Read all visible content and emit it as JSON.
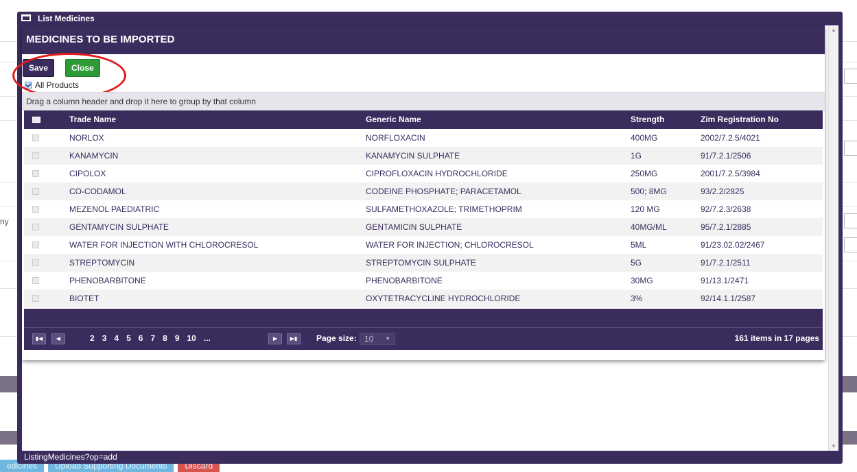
{
  "window": {
    "title": "List Medicines",
    "status_text": "ListingMedicines?op=add"
  },
  "panel": {
    "title": "MEDICINES TO BE IMPORTED",
    "save_label": "Save",
    "close_label": "Close",
    "all_products_label": "All Products",
    "all_products_checked": true
  },
  "grid": {
    "group_hint": "Drag a column header and drop it here to group by that column",
    "columns": [
      "Trade Name",
      "Generic Name",
      "Strength",
      "Zim Registration No"
    ],
    "rows": [
      {
        "trade": "NORLOX",
        "generic": "NORFLOXACIN",
        "strength": "400MG",
        "reg": "2002/7.2.5/4021"
      },
      {
        "trade": "KANAMYCIN",
        "generic": "KANAMYCIN SULPHATE",
        "strength": "1G",
        "reg": "91/7.2.1/2506"
      },
      {
        "trade": "CIPOLOX",
        "generic": "CIPROFLOXACIN HYDROCHLORIDE",
        "strength": "250MG",
        "reg": "2001/7.2.5/3984"
      },
      {
        "trade": "CO-CODAMOL",
        "generic": "CODEINE PHOSPHATE; PARACETAMOL",
        "strength": "500; 8MG",
        "reg": "93/2.2/2825"
      },
      {
        "trade": "MEZENOL PAEDIATRIC",
        "generic": "SULFAMETHOXAZOLE; TRIMETHOPRIM",
        "strength": "120 MG",
        "reg": "92/7.2.3/2638"
      },
      {
        "trade": "GENTAMYCIN SULPHATE",
        "generic": "GENTAMICIN SULPHATE",
        "strength": "40MG/ML",
        "reg": "95/7.2.1/2885"
      },
      {
        "trade": "WATER FOR INJECTION WITH CHLOROCRESOL",
        "generic": "WATER FOR INJECTION; CHLOROCRESOL",
        "strength": "5ML",
        "reg": "91/23.02.02/2467"
      },
      {
        "trade": "STREPTOMYCIN",
        "generic": "STREPTOMYCIN SULPHATE",
        "strength": "5G",
        "reg": "91/7.2.1/2511"
      },
      {
        "trade": "PHENOBARBITONE",
        "generic": "PHENOBARBITONE",
        "strength": "30MG",
        "reg": "91/13.1/2471"
      },
      {
        "trade": "BIOTET",
        "generic": "OXYTETRACYCLINE HYDROCHLORIDE",
        "strength": "3%",
        "reg": "92/14.1.1/2587"
      }
    ]
  },
  "pager": {
    "pages": [
      "2",
      "3",
      "4",
      "5",
      "6",
      "7",
      "8",
      "9",
      "10",
      "..."
    ],
    "page_size_label": "Page size:",
    "page_size_value": "10",
    "info": "161 items in 17 pages"
  },
  "background": {
    "tabs": [
      "edicines",
      "Upload Supporting Documents",
      "Discard"
    ],
    "tab_colors": [
      "#6fb7de",
      "#6fb7de",
      "#d9534f"
    ],
    "side_text": "ny"
  },
  "colors": {
    "primary": "#3b2c5e",
    "close_button": "#2e9a38",
    "annotation": "#e01b1b"
  }
}
